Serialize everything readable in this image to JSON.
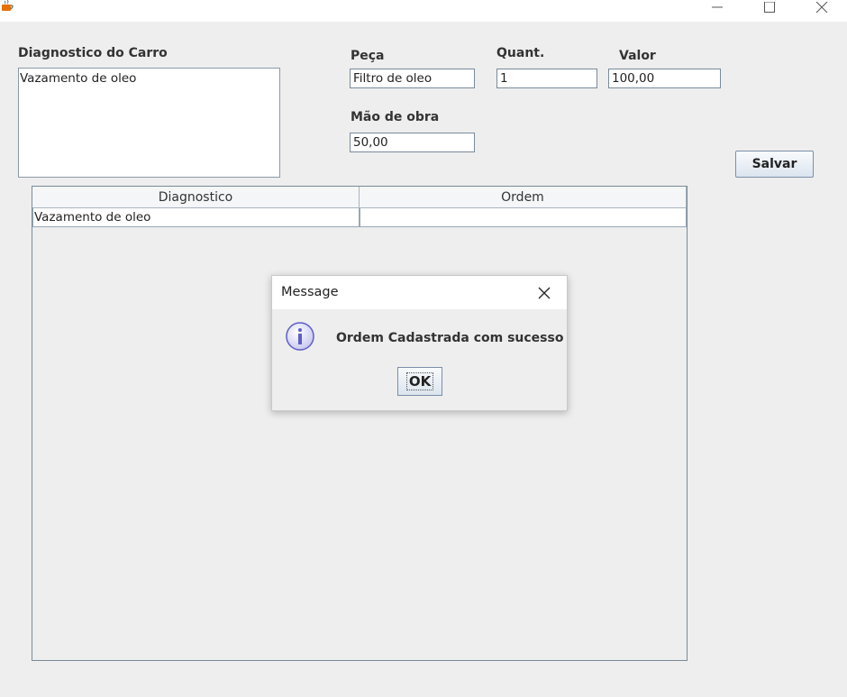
{
  "window": {
    "icons": {
      "app": "java-cup-icon",
      "minimize": "minimize-icon",
      "maximize": "maximize-icon",
      "close": "close-icon"
    }
  },
  "form": {
    "diagnostico_label": "Diagnostico do Carro",
    "diagnostico_value": "Vazamento de oleo",
    "peca_label": "Peça",
    "peca_value": "Filtro de oleo",
    "quant_label": "Quant.",
    "quant_value": "1",
    "valor_label": "Valor",
    "valor_value": "100,00",
    "mao_label": "Mão de obra",
    "mao_value": "50,00",
    "salvar_label": "Salvar"
  },
  "table": {
    "columns": [
      "Diagnostico",
      "Ordem"
    ],
    "rows": [
      [
        "Vazamento de oleo",
        ""
      ]
    ]
  },
  "dialog": {
    "title": "Message",
    "message": "Ordem Cadastrada com sucesso",
    "ok_label": "OK",
    "icon": "info-icon"
  },
  "colors": {
    "background": "#eeeeee",
    "field_border": "#7a8a99",
    "info_icon": "#5e5ec8"
  }
}
